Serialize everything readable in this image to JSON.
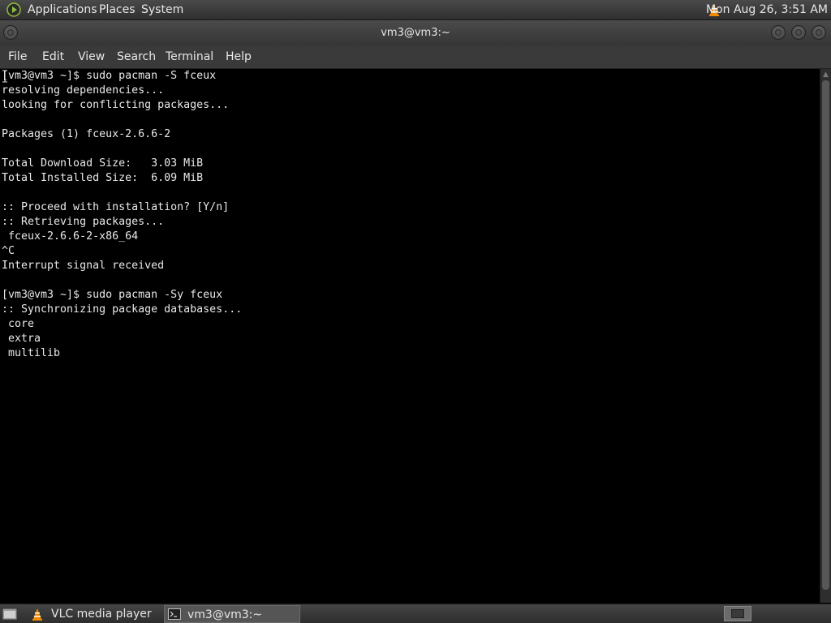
{
  "top_panel": {
    "menus": [
      "Applications",
      "Places",
      "System"
    ],
    "clock": "Mon Aug 26,  3:51 AM"
  },
  "window": {
    "title": "vm3@vm3:~",
    "menus": [
      "File",
      "Edit",
      "View",
      "Search",
      "Terminal",
      "Help"
    ]
  },
  "terminal": {
    "lines": [
      "[vm3@vm3 ~]$ sudo pacman -S fceux",
      "resolving dependencies...",
      "looking for conflicting packages...",
      "",
      "Packages (1) fceux-2.6.6-2",
      "",
      "Total Download Size:   3.03 MiB",
      "Total Installed Size:  6.09 MiB",
      "",
      ":: Proceed with installation? [Y/n]",
      ":: Retrieving packages...",
      " fceux-2.6.6-2-x86_64",
      "^C",
      "Interrupt signal received",
      "",
      "[vm3@vm3 ~]$ sudo pacman -Sy fceux",
      ":: Synchronizing package databases...",
      " core",
      " extra",
      " multilib"
    ]
  },
  "taskbar": {
    "tasks": [
      {
        "label": "VLC media player",
        "icon": "vlc-cone-icon",
        "active": false
      },
      {
        "label": "vm3@vm3:~",
        "icon": "terminal-icon",
        "active": true
      }
    ]
  },
  "colors": {
    "accent_vlc": "#f08a00",
    "panel_bg": "#3a3a3a",
    "terminal_bg": "#000000",
    "terminal_fg": "#e9e9e9"
  }
}
